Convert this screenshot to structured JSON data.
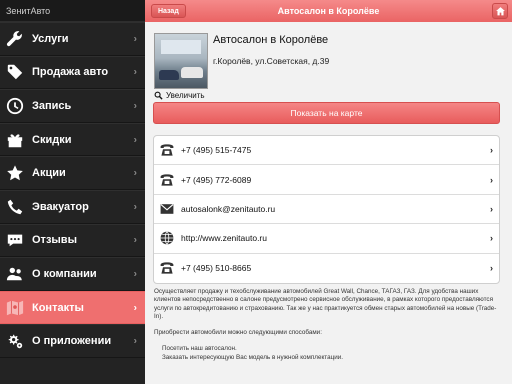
{
  "app": {
    "title": "ЗенитАвто"
  },
  "sidebar": {
    "items": [
      {
        "label": "Услуги",
        "icon": "wrench-icon"
      },
      {
        "label": "Продажа авто",
        "icon": "price-tag-icon"
      },
      {
        "label": "Запись",
        "icon": "clock-icon"
      },
      {
        "label": "Скидки",
        "icon": "gift-icon"
      },
      {
        "label": "Акции",
        "icon": "star-icon"
      },
      {
        "label": "Эвакуатор",
        "icon": "phone-handset-icon"
      },
      {
        "label": "Отзывы",
        "icon": "chat-bubble-icon"
      },
      {
        "label": "О компании",
        "icon": "people-icon"
      },
      {
        "label": "Контакты",
        "icon": "map-icon",
        "active": true
      },
      {
        "label": "О приложении",
        "icon": "gears-icon"
      }
    ]
  },
  "topbar": {
    "back_label": "Назад",
    "title": "Автосалон в Королёве",
    "home_icon": "home-icon"
  },
  "dealer": {
    "name": "Автосалон в Королёве",
    "address": "г.Королёв, ул.Советская, д.39",
    "zoom_label": "Увеличить"
  },
  "map_button": {
    "label": "Показать на карте"
  },
  "contacts": [
    {
      "type": "phone",
      "icon": "telephone-icon",
      "text": "+7 (495) 515-7475"
    },
    {
      "type": "phone",
      "icon": "telephone-icon",
      "text": "+7 (495) 772-6089"
    },
    {
      "type": "email",
      "icon": "envelope-icon",
      "text": "autosalonk@zenitauto.ru"
    },
    {
      "type": "web",
      "icon": "globe-icon",
      "text": "http://www.zenitauto.ru"
    },
    {
      "type": "phone",
      "icon": "telephone-icon",
      "text": "+7 (495) 510-8665"
    }
  ],
  "description": {
    "paragraph1": "Осуществляет продажу и техобслуживание автомобилей Great Wall, Chance, ТАГАЗ, ГАЗ. Для удобства наших клиентов непосредственно в салоне предусмотрено сервисное обслуживание, в рамках которого предоставляются услуги по автокредитованию и страхованию. Так же у нас практикуется обмен старых автомобилей на новые (Trade-In).",
    "paragraph2": "Приобрести автомобили можно следующими способами:",
    "way1": "Посетить наш автосалон.",
    "way2": "Заказать интересующую Вас модель в нужной комплектации."
  },
  "colors": {
    "accent": "#ef6f6f",
    "sidebar_bg": "#232323",
    "content_bg": "#f2f2f2"
  }
}
